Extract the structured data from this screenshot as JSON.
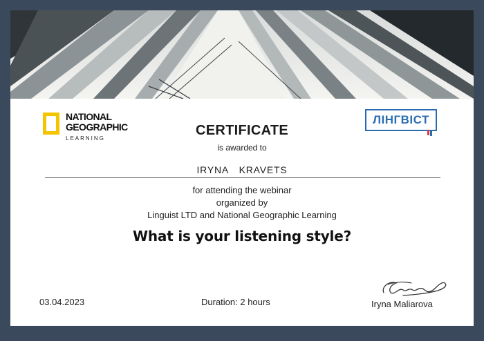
{
  "logos": {
    "national_geographic": {
      "line1": "NATIONAL",
      "line2": "GEOGRAPHIC",
      "line3": "LEARNING",
      "frame_color": "#f5c400"
    },
    "lingvist": {
      "text": "ЛІНГВІСТ",
      "color": "#2b6cb0",
      "accent_color": "#d93a3a"
    }
  },
  "certificate": {
    "title": "CERTIFICATE",
    "awarded_to": "is awarded to",
    "recipient": "IRYNA  KRAVETS",
    "line1": "for attending the webinar",
    "line2": "organized by",
    "line3": "Linguist LTD and National Geographic Learning",
    "webinar_title": "What is your listening style?"
  },
  "footer": {
    "date": "03.04.2023",
    "duration": "Duration: 2 hours",
    "signer": "Iryna Maliarova"
  }
}
